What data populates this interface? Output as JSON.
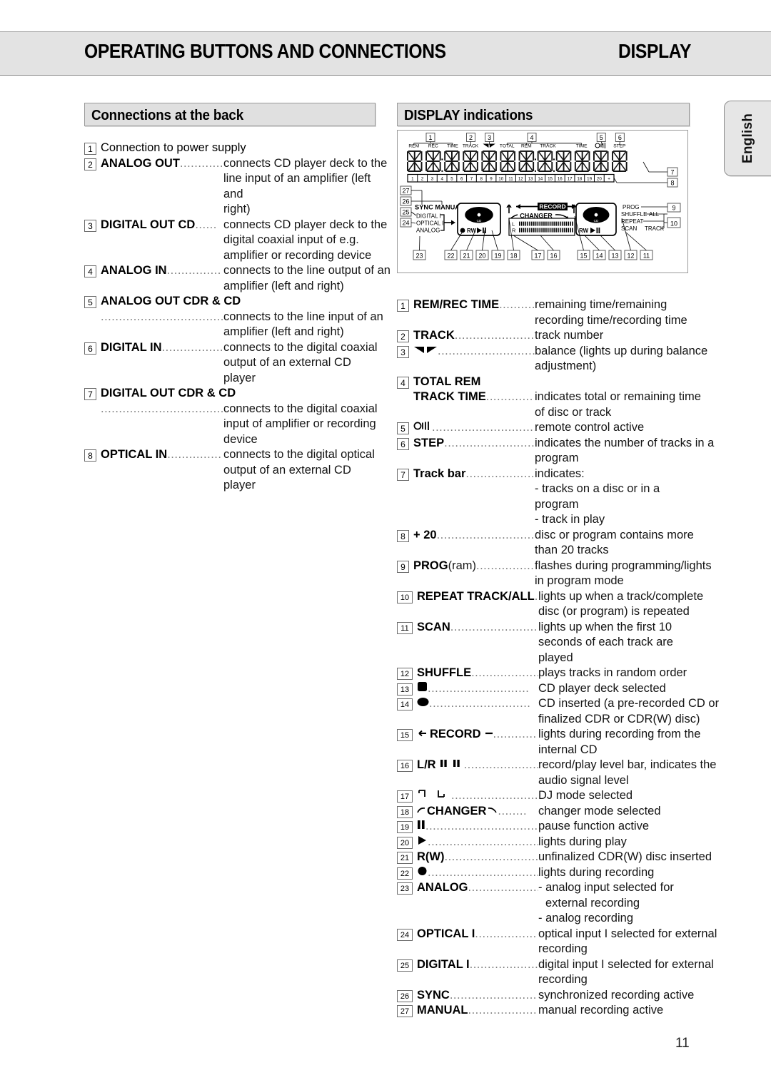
{
  "header": {
    "title": "OPERATING BUTTONS AND CONNECTIONS",
    "subtitle": "DISPLAY"
  },
  "side_tab": {
    "label": "English"
  },
  "page_number": "11",
  "left_section": {
    "title": "Connections at the back",
    "items": [
      {
        "num": "1",
        "term": "Connection to power supply",
        "term_bold": false,
        "leader": "",
        "desc": "",
        "cont": []
      },
      {
        "num": "2",
        "term": "ANALOG OUT",
        "term_bold": true,
        "leader": "............",
        "desc": "connects CD player deck to the",
        "cont": [
          "line input of an amplifier (left and",
          "right)"
        ]
      },
      {
        "num": "3",
        "term": "DIGITAL OUT CD",
        "term_bold": true,
        "leader": "......",
        "desc": "connects CD player deck to the",
        "cont": [
          "digital coaxial input of e.g.",
          "amplifier or recording device"
        ]
      },
      {
        "num": "4",
        "term": "ANALOG IN",
        "term_bold": true,
        "leader": "...............",
        "desc": "connects to the line output of an",
        "cont": [
          "amplifier (left and right)"
        ]
      },
      {
        "num": "5",
        "term": "ANALOG OUT CDR & CD",
        "term_bold": true,
        "leader": ".....................................",
        "desc": "connects to the line input of an",
        "cont": [
          "amplifier (left and right)"
        ],
        "term_own_line": true
      },
      {
        "num": "6",
        "term": "DIGITAL IN",
        "term_bold": true,
        "leader": ".................",
        "desc": "connects to the digital coaxial",
        "cont": [
          "output of an external CD player"
        ]
      },
      {
        "num": "7",
        "term": "DIGITAL OUT CDR & CD",
        "term_bold": true,
        "leader": ".....................................",
        "desc": "connects to the digital coaxial",
        "cont": [
          "input of amplifier or recording",
          "device"
        ],
        "term_own_line": true
      },
      {
        "num": "8",
        "term": "OPTICAL IN",
        "term_bold": true,
        "leader": "...............",
        "desc": "connects to the digital optical",
        "cont": [
          "output of an external CD player"
        ]
      }
    ]
  },
  "right_section": {
    "title": "DISPLAY indications",
    "items": [
      {
        "num": "1",
        "term": "REM/REC TIME",
        "icon": "",
        "leader": "..........",
        "desc": "remaining time/remaining",
        "cont": [
          "recording time/recording time"
        ]
      },
      {
        "num": "2",
        "term": "TRACK",
        "icon": "",
        "leader": ".......................",
        "desc": "track number",
        "cont": []
      },
      {
        "num": "3",
        "term": "",
        "icon": "balance-icon",
        "leader": "..............................",
        "desc": "balance (lights up during balance",
        "cont": [
          "adjustment)"
        ]
      },
      {
        "num": "4",
        "term": "TOTAL REM",
        "term2": "TRACK TIME",
        "icon": "",
        "leader": ".............",
        "desc": "indicates total or remaining time",
        "cont": [
          "of disc or track"
        ],
        "two_line_term": true
      },
      {
        "num": "5",
        "term": "",
        "icon": "remote-icon",
        "leader": "...............................",
        "desc": "remote control active",
        "cont": []
      },
      {
        "num": "6",
        "term": "STEP",
        "icon": "",
        "leader": "..........................",
        "desc": "indicates the number of tracks in a",
        "cont": [
          "program"
        ]
      },
      {
        "num": "7",
        "term": "Track bar",
        "icon": "",
        "leader": "...................",
        "desc": "indicates:",
        "cont": [
          "- tracks on a disc or in a program",
          "- track in play"
        ]
      },
      {
        "num": "8",
        "term": "+ 20",
        "icon": "",
        "leader": "............................",
        "desc": "disc or program contains more",
        "cont": [
          "than 20 tracks"
        ]
      },
      {
        "num": "9",
        "term": "PROG",
        "term_suffix": "(ram)",
        "icon": "",
        "leader": ".................",
        "desc": "flashes during programming/lights",
        "cont": [
          "in program mode"
        ]
      },
      {
        "num": "10",
        "term": "REPEAT TRACK/ALL",
        "icon": "",
        "leader": "..",
        "desc": "lights up when a track/complete",
        "cont": [
          "disc (or program) is repeated"
        ]
      },
      {
        "num": "11",
        "term": "SCAN",
        "icon": "",
        "leader": "........................",
        "desc": "lights up when the first 10",
        "cont": [
          "seconds of each track are played"
        ]
      },
      {
        "num": "12",
        "term": "SHUFFLE",
        "icon": "",
        "leader": ".....................",
        "desc": "plays tracks in random order",
        "cont": []
      },
      {
        "num": "13",
        "term": "",
        "icon": "square-icon",
        "leader": "............................",
        "desc": "CD player deck selected",
        "cont": []
      },
      {
        "num": "14",
        "term": "",
        "icon": "disc-icon",
        "leader": "............................",
        "desc": "CD inserted (a pre-recorded CD or",
        "cont": [
          "finalized CDR or CDR(W) disc)"
        ]
      },
      {
        "num": "15",
        "term": "RECORD",
        "icon": "record-arrows-icon",
        "leader": "............",
        "desc": "lights during recording from the",
        "cont": [
          "internal CD"
        ]
      },
      {
        "num": "16",
        "term": "L/R",
        "icon": "level-bars-icon",
        "leader": ".......................",
        "desc": "record/play level bar, indicates the",
        "cont": [
          "audio signal level"
        ]
      },
      {
        "num": "17",
        "term": "",
        "icon": "dj-mode-icon",
        "leader": "........................",
        "desc": "DJ mode selected",
        "cont": []
      },
      {
        "num": "18",
        "term": "CHANGER",
        "icon": "changer-arrows-icon",
        "leader": "........",
        "desc": "changer mode selected",
        "cont": []
      },
      {
        "num": "19",
        "term": "",
        "icon": "pause-icon",
        "leader": "..................................",
        "desc": "pause function active",
        "cont": []
      },
      {
        "num": "20",
        "term": "",
        "icon": "play-icon",
        "leader": "...............................",
        "desc": "lights during play",
        "cont": []
      },
      {
        "num": "21",
        "term": "R(W)",
        "icon": "",
        "leader": "............................",
        "desc": "unfinalized CDR(W) disc inserted",
        "cont": []
      },
      {
        "num": "22",
        "term": "",
        "icon": "record-dot-icon",
        "leader": "..................................",
        "desc": "lights during recording",
        "cont": []
      },
      {
        "num": "23",
        "term": "ANALOG",
        "icon": "",
        "leader": ".....................",
        "desc": "- analog input selected for",
        "cont": [
          "external recording",
          "- analog recording"
        ],
        "cont_indent": [
          true,
          false
        ]
      },
      {
        "num": "24",
        "term": "OPTICAL I",
        "icon": "",
        "leader": ".................",
        "desc": "optical input I selected for external",
        "cont": [
          "recording"
        ]
      },
      {
        "num": "25",
        "term": "DIGITAL I",
        "icon": "",
        "leader": "...................",
        "desc": "digital input I selected for external",
        "cont": [
          "recording"
        ]
      },
      {
        "num": "26",
        "term": "SYNC",
        "icon": "",
        "leader": "........................",
        "desc": "synchronized recording active",
        "cont": []
      },
      {
        "num": "27",
        "term": "MANUAL",
        "icon": "",
        "leader": "...................",
        "desc": "manual recording active",
        "cont": []
      }
    ]
  },
  "display_figure": {
    "top_callouts": [
      "1",
      "2",
      "3",
      "4",
      "5",
      "6"
    ],
    "segment_labels_group1": [
      "REM",
      "REC",
      "TIME"
    ],
    "segment_label_track": "TRACK",
    "segment_labels_group4": [
      "TOTAL",
      "REM",
      "TRACK",
      "TIME"
    ],
    "segment_label_step": "STEP",
    "track_bar_numbers": [
      "1",
      "2",
      "3",
      "4",
      "5",
      "6",
      "7",
      "8",
      "9",
      "10",
      "11",
      "12",
      "13",
      "14",
      "15",
      "16",
      "17",
      "18",
      "19",
      "20",
      "+"
    ],
    "right_callouts": [
      "7",
      "8",
      "9",
      "10"
    ],
    "left_callouts": [
      "27",
      "26",
      "25",
      "24"
    ],
    "bottom_callouts": [
      "23",
      "22",
      "21",
      "20",
      "19",
      "18",
      "17",
      "16",
      "15",
      "14",
      "13",
      "12",
      "11"
    ],
    "sync_manual": "SYNC MANUAL",
    "input_labels": [
      "DIGITAL I",
      "OPTICAL I",
      "ANALOG"
    ],
    "record_label": "RECORD",
    "changer_label": "CHANGER",
    "deck_labels": {
      "left_rw": "RW",
      "right_rw": "RW",
      "cd": "CD"
    },
    "level_channels": [
      "L",
      "R"
    ],
    "mode_labels": [
      "PROG",
      "SHUFFLE",
      "ALL",
      "REPEAT",
      "SCAN",
      "TRACK"
    ],
    "digit_count": 12
  }
}
